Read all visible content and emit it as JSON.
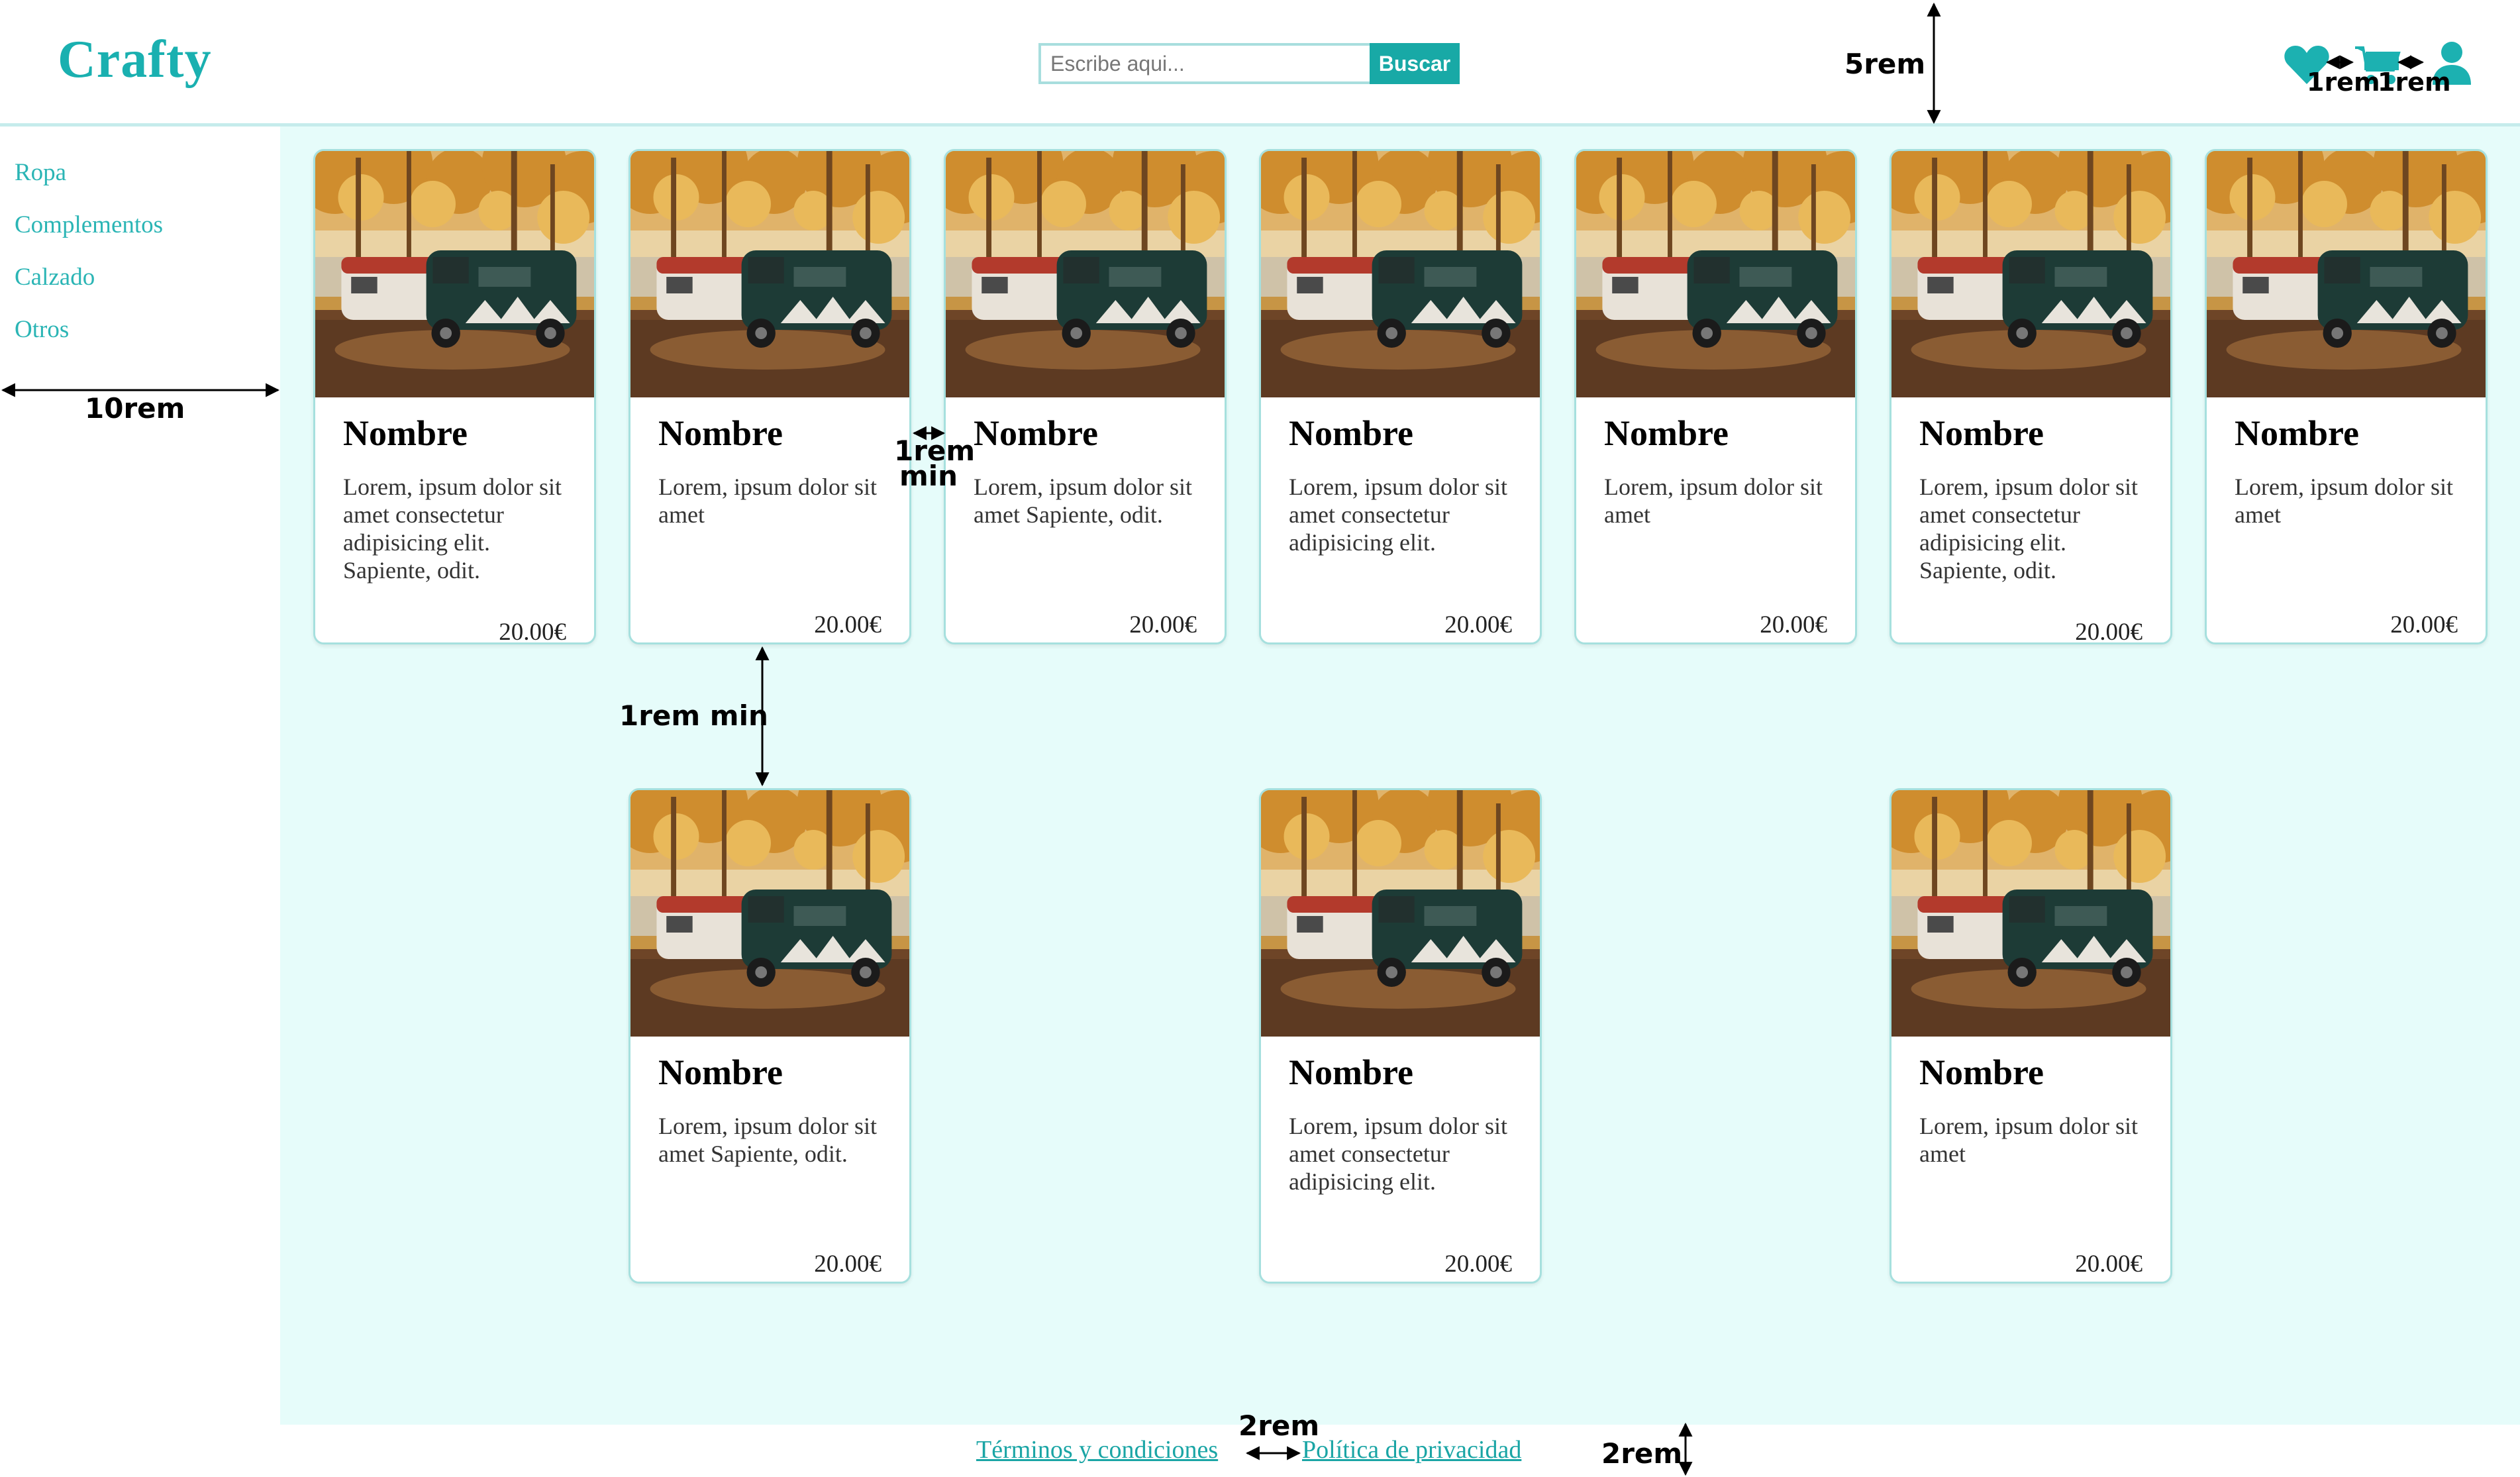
{
  "header": {
    "logo": "Crafty",
    "search": {
      "placeholder": "Escribe aqui...",
      "button_label": "Buscar"
    },
    "icons": [
      "heart-icon",
      "cart-icon",
      "user-icon"
    ]
  },
  "sidebar": {
    "items": [
      {
        "label": "Ropa"
      },
      {
        "label": "Complementos"
      },
      {
        "label": "Calzado"
      },
      {
        "label": "Otros"
      }
    ]
  },
  "products": [
    {
      "name": "Nombre",
      "description": "Lorem, ipsum dolor sit amet consectetur adipisicing elit. Sapiente, odit.",
      "price": "20.00€"
    },
    {
      "name": "Nombre",
      "description": "Lorem, ipsum dolor sit amet",
      "price": "20.00€"
    },
    {
      "name": "Nombre",
      "description": "Lorem, ipsum dolor sit amet Sapiente, odit.",
      "price": "20.00€"
    },
    {
      "name": "Nombre",
      "description": "Lorem, ipsum dolor sit amet consectetur adipisicing elit.",
      "price": "20.00€"
    },
    {
      "name": "Nombre",
      "description": "Lorem, ipsum dolor sit amet",
      "price": "20.00€"
    },
    {
      "name": "Nombre",
      "description": "Lorem, ipsum dolor sit amet consectetur adipisicing elit. Sapiente, odit.",
      "price": "20.00€"
    },
    {
      "name": "Nombre",
      "description": "Lorem, ipsum dolor sit amet",
      "price": "20.00€"
    },
    {
      "name": "Nombre",
      "description": "Lorem, ipsum dolor sit amet Sapiente, odit.",
      "price": "20.00€"
    },
    {
      "name": "Nombre",
      "description": "Lorem, ipsum dolor sit amet consectetur adipisicing elit.",
      "price": "20.00€"
    },
    {
      "name": "Nombre",
      "description": "Lorem, ipsum dolor sit amet",
      "price": "20.00€"
    }
  ],
  "footer": {
    "terms": "Términos y condiciones",
    "privacy": "Política de privacidad"
  },
  "annotations": {
    "header_height": "5rem",
    "icon_gap_1": "1rem",
    "icon_gap_2": "1rem",
    "sidebar_width": "10rem",
    "card_gap_h": "1rem min",
    "card_gap_v": "1rem min",
    "footer_gap": "2rem",
    "footer_height": "2rem"
  },
  "colors": {
    "accent": "#1ab0b0",
    "main_bg": "#e6fcfa",
    "card_border": "#a6e0de",
    "button_bg": "#18a9a6"
  }
}
